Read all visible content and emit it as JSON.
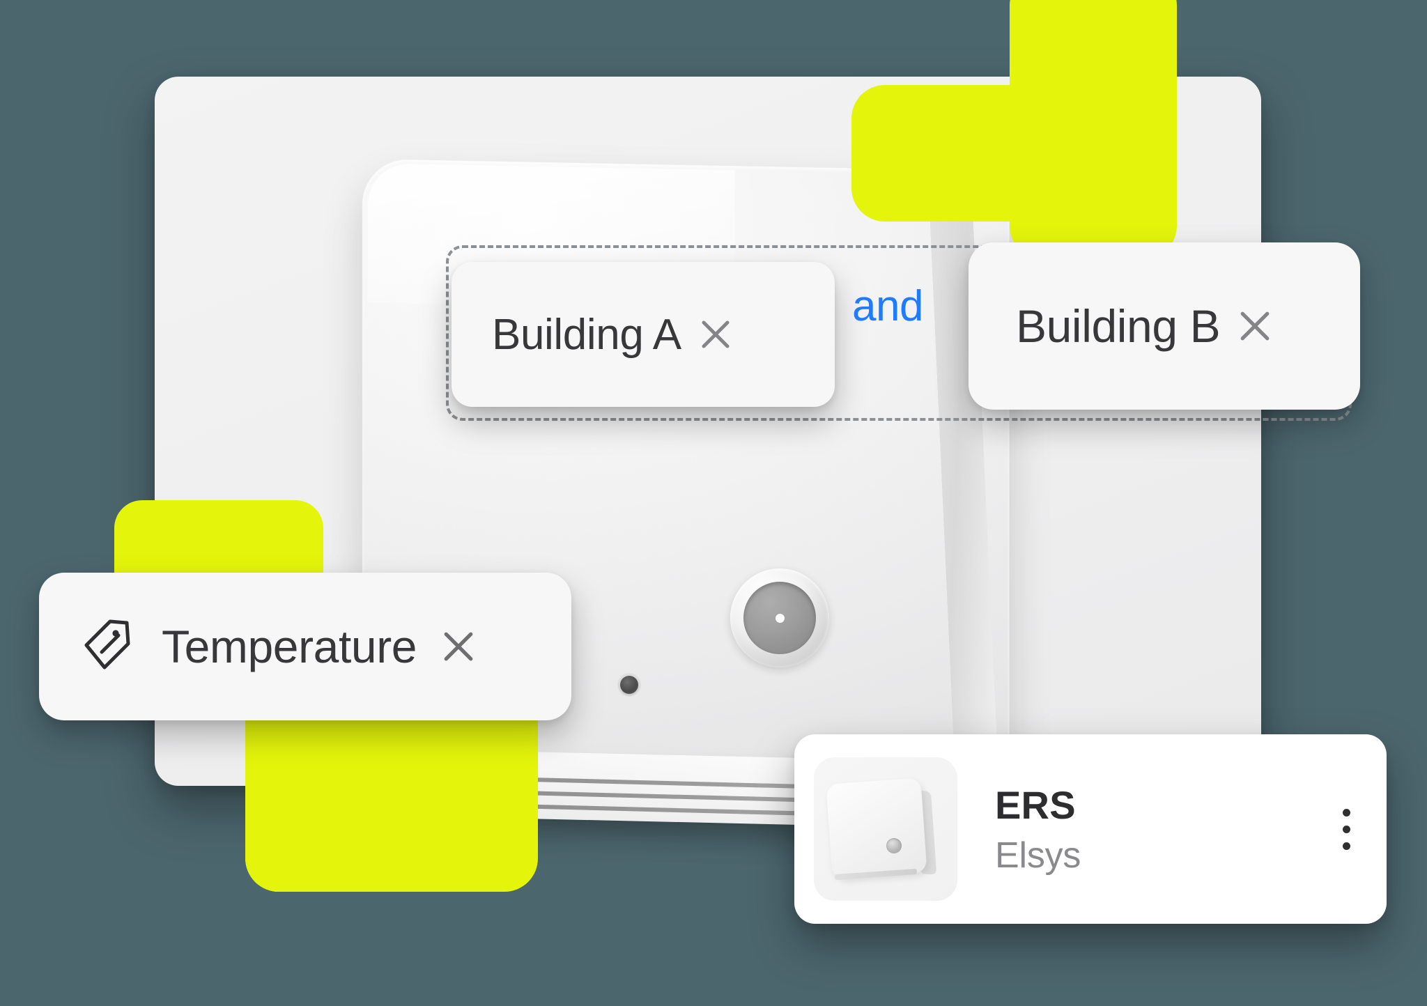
{
  "theme": {
    "background": "#4C666E",
    "accent_yellow": "#E4F50B",
    "brand_blue": "#1F7BFF",
    "chip_background": "#F7F7F7",
    "card_background": "#FFFFFF",
    "text_primary": "#38383A",
    "text_muted": "#8A8A8E",
    "dashed_border": "#8C9195"
  },
  "filter_builder": {
    "operator": "and",
    "location_chips": [
      {
        "label": "Building A",
        "close_icon": "close-icon"
      },
      {
        "label": "Building B",
        "close_icon": "close-icon"
      }
    ]
  },
  "measurement_chip": {
    "icon": "tag-icon",
    "label": "Temperature",
    "close_icon": "close-icon"
  },
  "device_card": {
    "thumbnail_icon": "sensor-device-thumbnail",
    "title": "ERS",
    "subtitle": "Elsys",
    "menu_icon": "more-vertical-icon"
  }
}
